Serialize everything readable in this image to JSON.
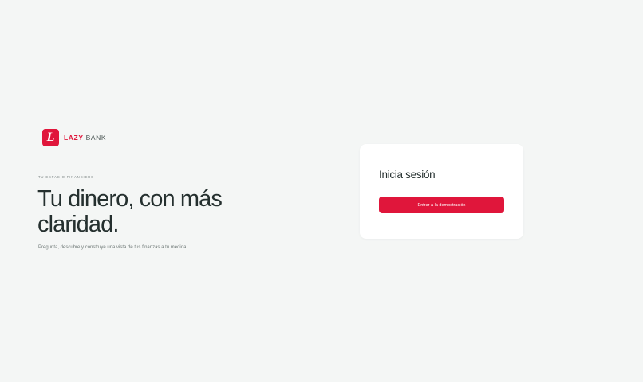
{
  "colors": {
    "accent": "#e0163b",
    "background": "#f4f6f5",
    "card": "#ffffff",
    "text": "#25302f"
  },
  "brand": {
    "logo_letter": "L",
    "name_bold": "LAZY",
    "name_regular": "BANK"
  },
  "hero": {
    "eyebrow": "TU ESPACIO FINANCIERO",
    "headline": "Tu dinero, con más claridad.",
    "subtitle": "Pregunta, descubre y construye una vista de tus finanzas a tu medida."
  },
  "login": {
    "title": "Inicia sesión",
    "demo_button_label": "Entrar a la demostración"
  }
}
